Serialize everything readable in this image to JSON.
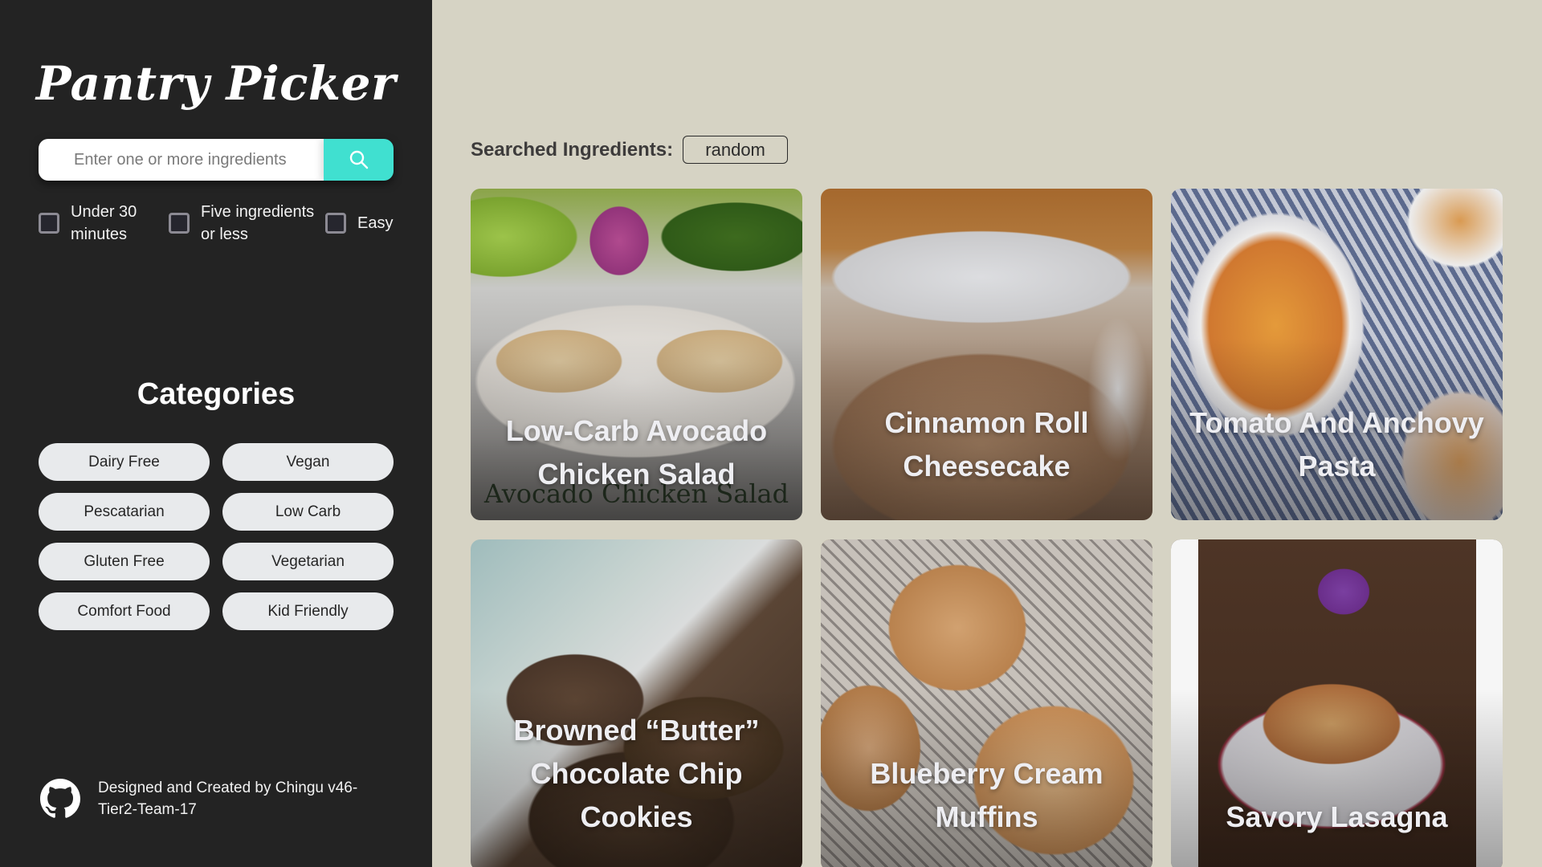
{
  "app": {
    "title": "Pantry Picker"
  },
  "search": {
    "placeholder": "Enter one or more ingredients",
    "value": "",
    "button_icon": "search-icon"
  },
  "filters": [
    {
      "label": "Under 30 minutes",
      "checked": false
    },
    {
      "label": "Five ingredients or less",
      "checked": false
    },
    {
      "label": "Easy",
      "checked": false
    }
  ],
  "categories": {
    "title": "Categories",
    "items": [
      "Dairy Free",
      "Vegan",
      "Pescatarian",
      "Low Carb",
      "Gluten Free",
      "Vegetarian",
      "Comfort Food",
      "Kid Friendly"
    ]
  },
  "footer": {
    "icon": "github-icon",
    "credit": "Designed and Created by Chingu v46-Tier2-Team-17"
  },
  "main": {
    "searched_label": "Searched Ingredients:",
    "searched_tags": [
      "random"
    ],
    "recipes": [
      {
        "title": "Low-Carb Avocado Chicken Salad",
        "image": "salad",
        "photo_caption": "Avocado Chicken Salad"
      },
      {
        "title": "Cinnamon Roll Cheesecake",
        "image": "cheesecake"
      },
      {
        "title": "Tomato And Anchovy Pasta",
        "image": "pasta"
      },
      {
        "title": "Browned “Butter” Chocolate Chip Cookies",
        "image": "cookies"
      },
      {
        "title": "Blueberry Cream Muffins",
        "image": "muffins"
      },
      {
        "title": "Savory Lasagna",
        "image": "lasagna"
      }
    ]
  },
  "colors": {
    "sidebar_bg": "#232323",
    "main_bg": "#d6d3c4",
    "accent": "#40e0d0",
    "chip_bg": "#e8eaec"
  }
}
